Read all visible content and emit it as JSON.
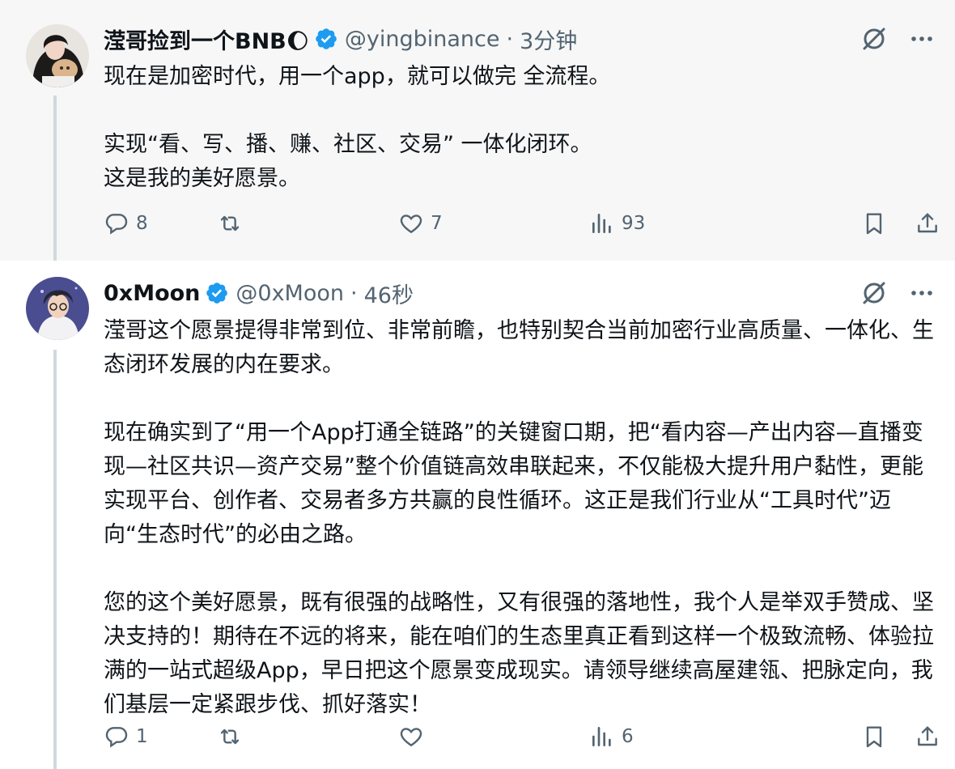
{
  "tweets": [
    {
      "author_name": "滢哥捡到一个BNB🌔",
      "handle": "@yingbinance",
      "separator": "·",
      "time": "3分钟",
      "paragraphs": [
        "现在是加密时代，用一个app，就可以做完 全流程。",
        "实现“看、写、播、赚、社区、交易” 一体化闭环。\n这是我的美好愿景。"
      ],
      "replies": "8",
      "retweets": "",
      "likes": "7",
      "views": "93"
    },
    {
      "author_name": "0xMoon",
      "handle": "@0xMoon",
      "separator": "·",
      "time": "46秒",
      "paragraphs": [
        "滢哥这个愿景提得非常到位、非常前瞻，也特别契合当前加密行业高质量、一体化、生态闭环发展的内在要求。",
        "现在确实到了“用一个App打通全链路”的关键窗口期，把“看内容—产出内容—直播变现—社区共识—资产交易”整个价值链高效串联起来，不仅能极大提升用户黏性，更能实现平台、创作者、交易者多方共赢的良性循环。这正是我们行业从“工具时代”迈向“生态时代”的必由之路。",
        "您的这个美好愿景，既有很强的战略性，又有很强的落地性，我个人是举双手赞成、坚决支持的！期待在不远的将来，能在咱们的生态里真正看到这样一个极致流畅、体验拉满的一站式超级App，早日把这个愿景变成现实。请领导继续高屋建瓴、把脉定向，我们基层一定紧跟步伐、抓好落实！"
      ],
      "replies": "1",
      "retweets": "",
      "likes": "",
      "views": "6"
    }
  ],
  "colors": {
    "verified": "#1d9bf0",
    "icon_gray": "#536471",
    "thread_line": "#cfd9de"
  },
  "icons": [
    "grok-icon",
    "more-icon",
    "reply-icon",
    "retweet-icon",
    "like-icon",
    "views-icon",
    "bookmark-icon",
    "share-icon",
    "verified-badge-icon"
  ]
}
